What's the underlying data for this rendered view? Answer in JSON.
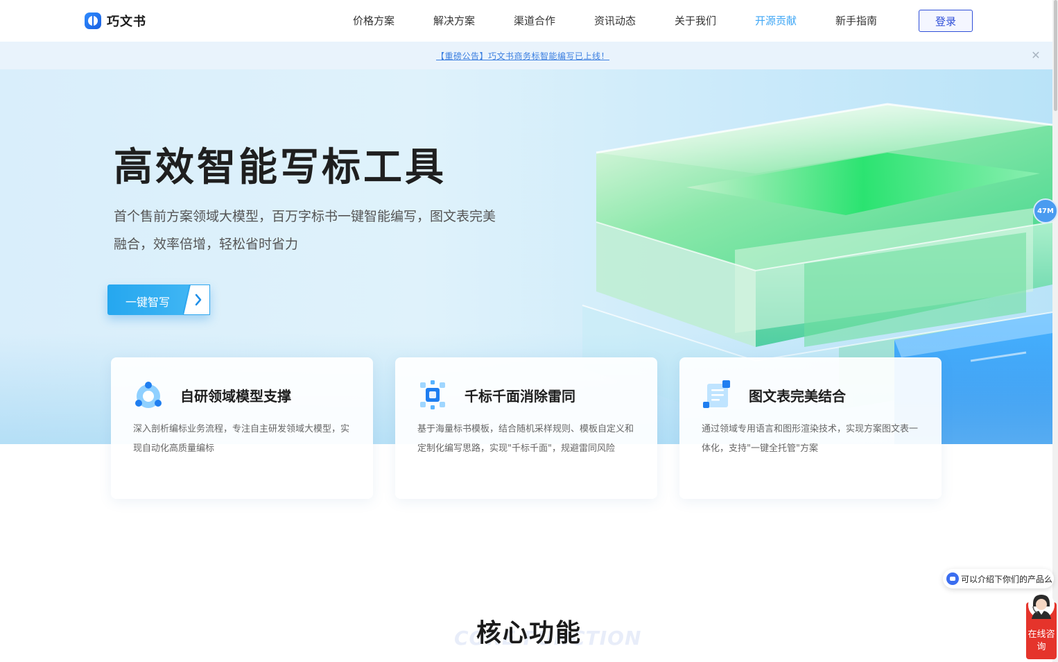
{
  "header": {
    "logo_text": "巧文书",
    "nav": [
      {
        "label": "价格方案",
        "active": false
      },
      {
        "label": "解决方案",
        "active": false
      },
      {
        "label": "渠道合作",
        "active": false
      },
      {
        "label": "资讯动态",
        "active": false
      },
      {
        "label": "关于我们",
        "active": false
      },
      {
        "label": "开源贡献",
        "active": true
      },
      {
        "label": "新手指南",
        "active": false
      }
    ],
    "login_label": "登录"
  },
  "announcement": {
    "text": "【重磅公告】巧文书商务标智能编写已上线！",
    "close_icon": "close-icon"
  },
  "hero": {
    "title": "高效智能写标工具",
    "subtitle": "首个售前方案领域大模型，百万字标书一键智能编写，图文表完美融合，效率倍增，轻松省时省力",
    "cta_label": "一键智写"
  },
  "features": [
    {
      "icon": "domain-model-icon",
      "title": "自研领域模型支撑",
      "desc": "深入剖析编标业务流程，专注自主研发领域大模型，实现自动化高质量编标"
    },
    {
      "icon": "unique-content-icon",
      "title": "千标千面消除雷同",
      "desc": "基于海量标书模板，结合随机采样规则、模板自定义和定制化编写思路，实现\"千标千面\"，规避雷同风险"
    },
    {
      "icon": "document-chart-icon",
      "title": "图文表完美结合",
      "desc": "通过领域专用语言和图形渲染技术，实现方案图文表一体化，支持\"一键全托管\"方案"
    }
  ],
  "section": {
    "title": "核心功能",
    "title_en": "CORE FUNCTION"
  },
  "widgets": {
    "memory_badge": "47M",
    "chat_prompt": "可以介绍下你们的产品么",
    "consult_label": "在线咨询"
  },
  "colors": {
    "brand_blue": "#2f4fd8",
    "accent_blue": "#3ea6f5",
    "consult_red": "#e5342b"
  }
}
